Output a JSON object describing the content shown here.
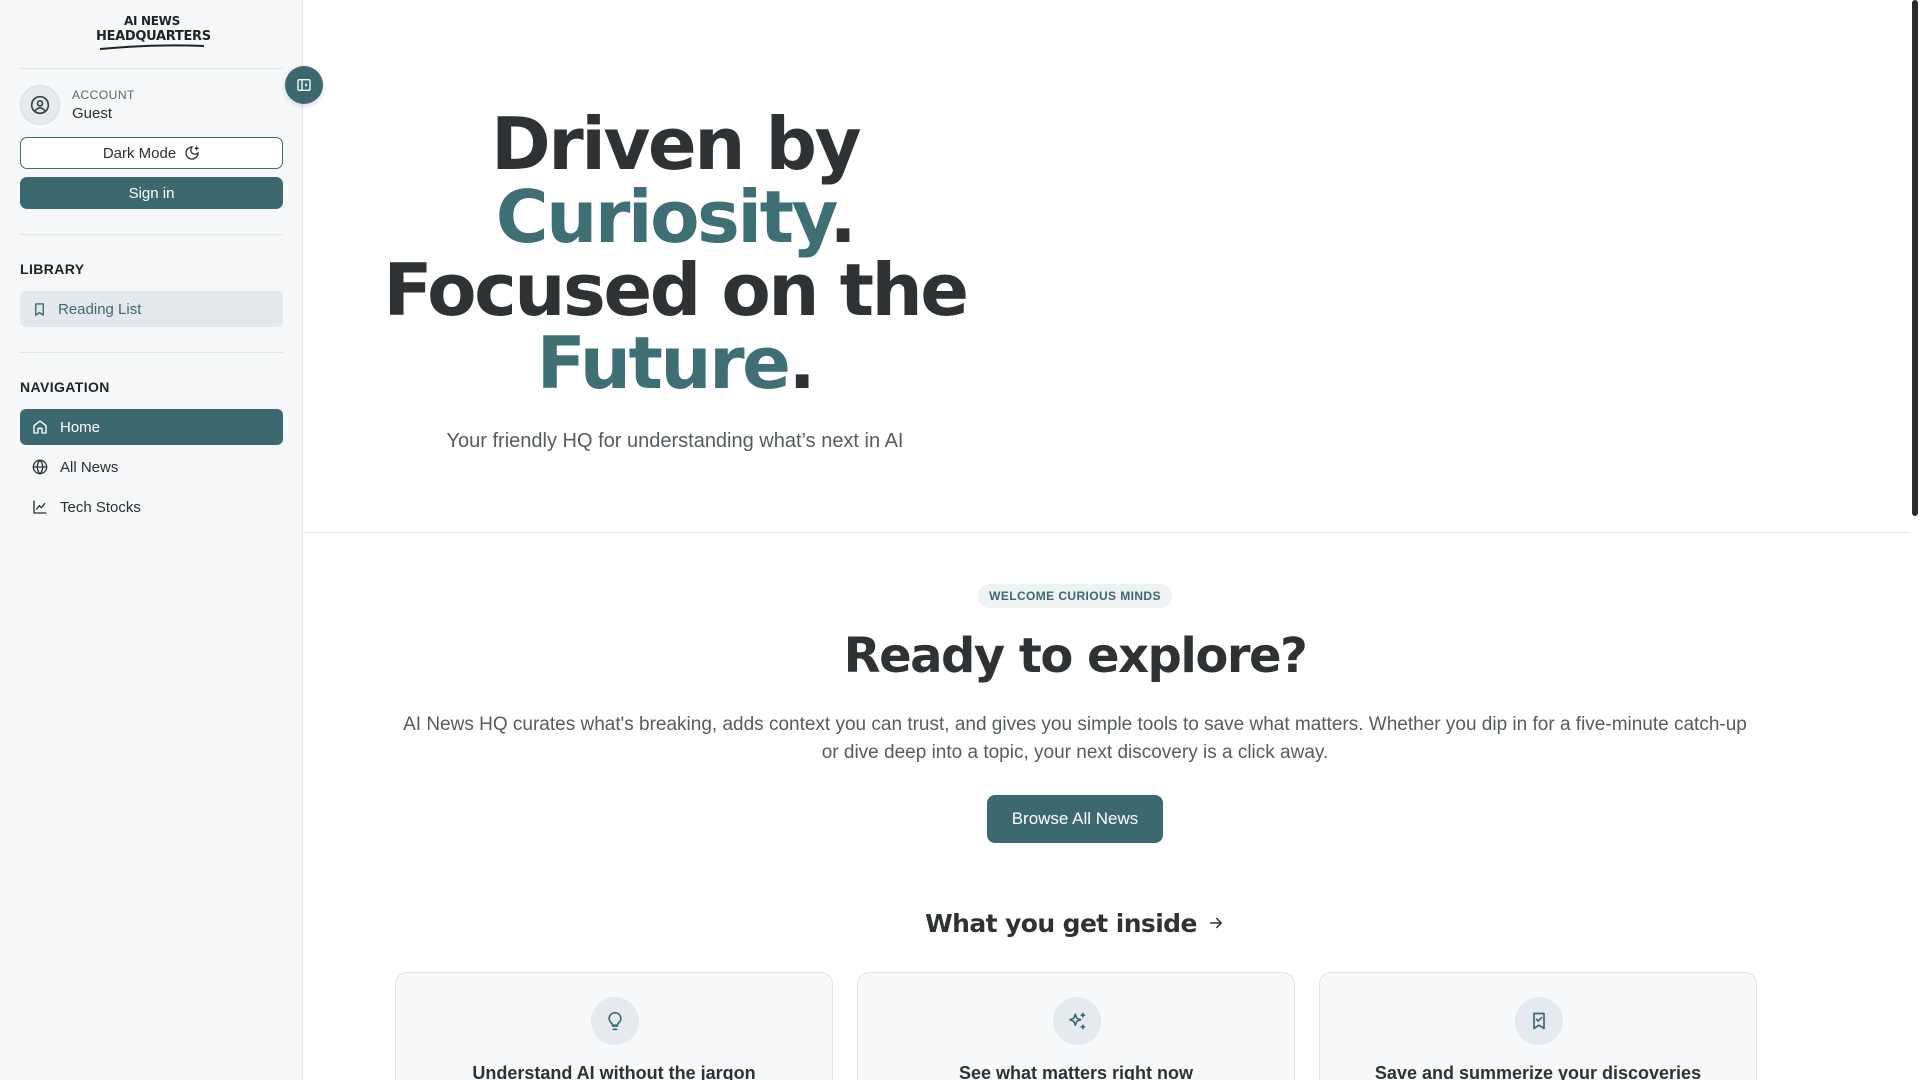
{
  "sidebar": {
    "logo_line1": "AI NEWS",
    "logo_line2": "HEADQUARTERS",
    "account": {
      "label": "ACCOUNT",
      "name": "Guest"
    },
    "dark_mode_label": "Dark Mode",
    "sign_in_label": "Sign in",
    "library": {
      "title": "LIBRARY",
      "items": [
        {
          "label": "Reading List",
          "icon": "bookmark-icon"
        }
      ]
    },
    "navigation": {
      "title": "NAVIGATION",
      "items": [
        {
          "label": "Home",
          "icon": "home-icon",
          "active": true
        },
        {
          "label": "All News",
          "icon": "globe-icon"
        },
        {
          "label": "Tech Stocks",
          "icon": "line-chart-icon"
        }
      ]
    }
  },
  "hero": {
    "line1": "Driven by",
    "line2_accent": "Curiosity",
    "line2_end": ".",
    "line3": "Focused on the",
    "line4_accent": "Future",
    "line4_end": ".",
    "subtitle": "Your friendly HQ for understanding what’s next in AI"
  },
  "welcome": {
    "badge": "WELCOME CURIOUS MINDS",
    "title": "Ready to explore?",
    "text": "AI News HQ curates what's breaking, adds context you can trust, and gives you simple tools to save what matters. Whether you dip in for a five-minute catch-up or dive deep into a topic, your next discovery is a click away.",
    "browse_label": "Browse All News"
  },
  "inside": {
    "title": "What you get inside",
    "cards": [
      {
        "title": "Understand AI without the jargon",
        "icon": "lightbulb-icon"
      },
      {
        "title": "See what matters right now",
        "icon": "sparkles-icon"
      },
      {
        "title": "Save and summerize your discoveries",
        "icon": "bookmark-check-icon"
      }
    ]
  },
  "colors": {
    "accent": "#3c6970",
    "sidebar_bg": "#f5f7f8",
    "heading": "#2f3235"
  }
}
